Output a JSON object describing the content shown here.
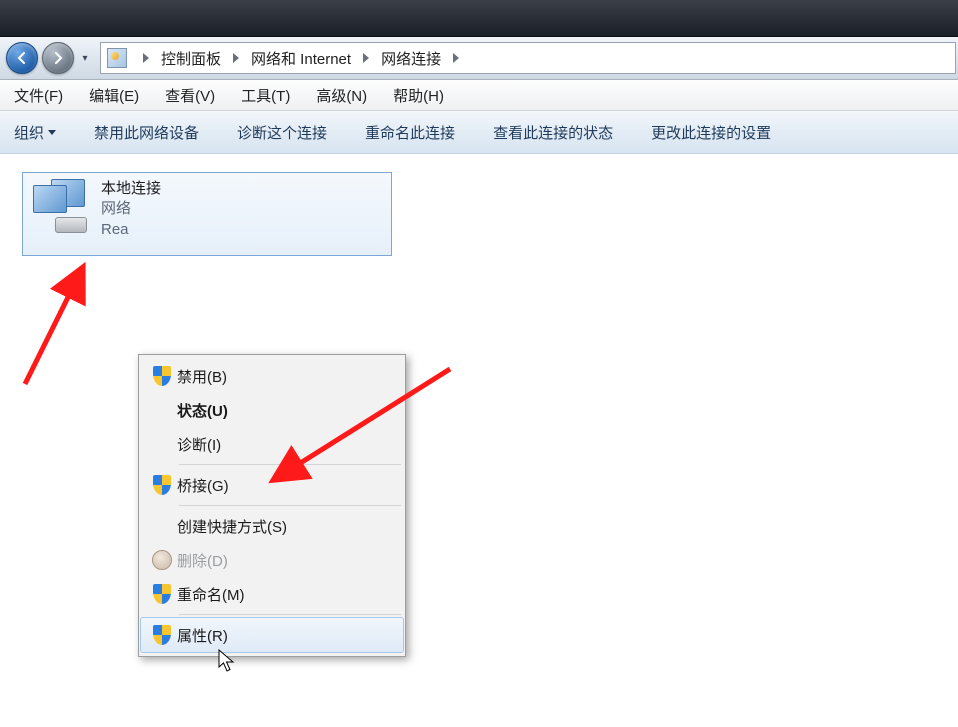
{
  "breadcrumbs": {
    "items": [
      "控制面板",
      "网络和 Internet",
      "网络连接"
    ]
  },
  "menubar": {
    "file": "文件(F)",
    "edit": "编辑(E)",
    "view": "查看(V)",
    "tools": "工具(T)",
    "adv": "高级(N)",
    "help": "帮助(H)"
  },
  "toolbar": {
    "organize": "组织",
    "disable": "禁用此网络设备",
    "diagnose": "诊断这个连接",
    "rename": "重命名此连接",
    "status": "查看此连接的状态",
    "change": "更改此连接的设置"
  },
  "connection": {
    "name": "本地连接",
    "status": "网络",
    "device": "Rea"
  },
  "context_menu": {
    "disable": "禁用(B)",
    "status": "状态(U)",
    "diagnose": "诊断(I)",
    "bridge": "桥接(G)",
    "shortcut": "创建快捷方式(S)",
    "delete": "删除(D)",
    "rename": "重命名(M)",
    "props": "属性(R)"
  }
}
